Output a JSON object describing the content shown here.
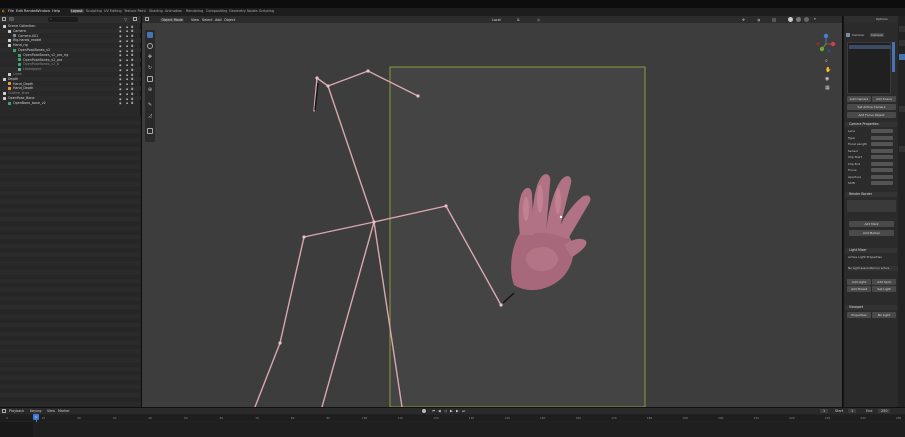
{
  "topbar": {
    "menus": [
      "File",
      "Edit",
      "Render",
      "Window",
      "Help"
    ],
    "workspaces": [
      "Layout",
      "Sculpting",
      "UV Editing",
      "Texture Paint",
      "Shading",
      "Animation",
      "Rendering",
      "Compositing",
      "Geometry Nodes",
      "Scripting"
    ],
    "active_workspace": "Layout"
  },
  "outliner": {
    "search_placeholder": "",
    "rows": [
      {
        "label": "Scene Collection",
        "indent": 0,
        "icon": "collection",
        "color": "#d0d0d0"
      },
      {
        "label": "Camera",
        "indent": 1,
        "icon": "collection",
        "color": "#d0d0d0"
      },
      {
        "label": "Camera.001",
        "indent": 2,
        "icon": "camera",
        "color": "#c8c8c8"
      },
      {
        "label": "Rig.hands_model",
        "indent": 1,
        "icon": "collection",
        "color": "#d0d0d0"
      },
      {
        "label": "Hand_rig",
        "indent": 1,
        "icon": "collection",
        "color": "#d0d0d0"
      },
      {
        "label": "OpenPoseBones_v2",
        "indent": 2,
        "icon": "armature",
        "color": "#d0d0d0"
      },
      {
        "label": "OpenPoseBones_v2_pro_rig",
        "indent": 3,
        "icon": "armature",
        "color": "#c8c8c8"
      },
      {
        "label": "OpenPoseBones_v2_pro",
        "indent": 3,
        "icon": "armature",
        "color": "#c8c8c8"
      },
      {
        "label": "OpenPoseBones_v2_b",
        "indent": 3,
        "icon": "armature",
        "color": "#8a8a8a"
      },
      {
        "label": "Lhandpoint",
        "indent": 3,
        "icon": "bone",
        "color": "#8a8a8a"
      },
      {
        "label": "Lines",
        "indent": 1,
        "icon": "collection",
        "color": "#8a8a8a"
      },
      {
        "label": "Depth",
        "indent": 0,
        "icon": "collection",
        "color": "#d0d0d0"
      },
      {
        "label": "Hand_Depth",
        "indent": 1,
        "icon": "mesh",
        "color": "#d0d0d0"
      },
      {
        "label": "Hand_Depth",
        "indent": 1,
        "icon": "mesh",
        "color": "#d0d0d0"
      },
      {
        "label": "Outline_lines",
        "indent": 0,
        "icon": "collection",
        "color": "#8a8a8a"
      },
      {
        "label": "OpenPose_Bone",
        "indent": 0,
        "icon": "collection",
        "color": "#d0d0d0"
      },
      {
        "label": "OpenBone_bone_v2",
        "indent": 1,
        "icon": "armature",
        "color": "#d0d0d0"
      }
    ]
  },
  "viewport": {
    "header": [
      "Object Mode",
      "View",
      "Select",
      "Add",
      "Object"
    ],
    "transform": "Local",
    "colors": {
      "background": "#3d3d3d",
      "skeleton": "#d9a7b0",
      "camera_frame": "#a0b43c",
      "hand": "#b07284"
    },
    "tools": [
      "cursor-icon",
      "select-icon",
      "move-icon",
      "rotate-icon",
      "scale-icon",
      "transform-icon",
      "annotate-icon",
      "measure-icon",
      "add-icon"
    ]
  },
  "properties": {
    "tab_title": "Options",
    "object_name": "Camera",
    "data_name": "Camera",
    "buttons": [
      "Add Camera",
      "Add Scene",
      "Set Active Camera",
      "Add Focus Object",
      "Add Mark",
      "Add Marker",
      "Add Preset",
      "Set Light"
    ],
    "rows": [
      "Camera Properties",
      "Lens",
      "Type",
      "Focal Length",
      "Sensor",
      "Clip Start",
      "Clip End",
      "Focus",
      "Aperture",
      "Shift",
      "Render Border",
      "Resolution",
      "Light Mixer",
      "Active Light Properties",
      "No Light",
      "Add Light",
      "Add Spot",
      "Properties",
      "Viewport"
    ],
    "light_mixer_title": "Light Mixer",
    "light_note": "No Light associated on active"
  },
  "timeline": {
    "menus": [
      "Playback",
      "Keying",
      "View",
      "Marker"
    ],
    "current_frame": "1",
    "ticks": [
      "0",
      "10",
      "20",
      "30",
      "40",
      "50",
      "60",
      "70",
      "80",
      "90",
      "100",
      "110",
      "120",
      "130",
      "140",
      "150",
      "160",
      "170",
      "180",
      "190",
      "200",
      "210",
      "220",
      "230",
      "240",
      "250"
    ],
    "start_label": "Start",
    "start": "1",
    "end_label": "End",
    "end": "250"
  }
}
